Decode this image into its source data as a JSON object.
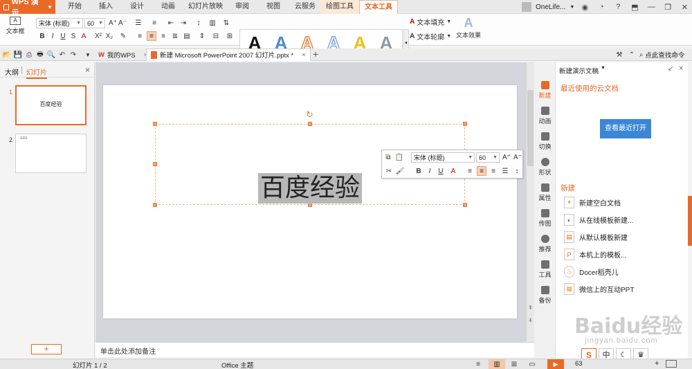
{
  "app": {
    "name": "WPS 演示"
  },
  "menu": {
    "tabs": [
      "开始",
      "插入",
      "设计",
      "动画",
      "幻灯片放映",
      "审阅",
      "视图",
      "云服务",
      "绘图工具",
      "文本工具"
    ],
    "user": "OneLife..."
  },
  "ribbon": {
    "textbox_label": "文本框",
    "font_name": "宋体 (标题)",
    "font_size": "60",
    "fill_label": "文本填充",
    "outline_label": "文本轮廓",
    "effect_label": "文本效果",
    "gallery_letter": "A",
    "gallery_colors": [
      "#111111",
      "#4a8bd1",
      "#e98246",
      "#7fa8d8",
      "#f2c018",
      "#8c99a8"
    ]
  },
  "tabs": {
    "home_tab": "我的WPS",
    "doc_tab": "新建 Microsoft PowerPoint 2007 幻灯片.pptx *",
    "search_placeholder": "点此查找命令"
  },
  "left_panel": {
    "tab_outline": "大纲",
    "tab_slides": "幻灯片",
    "slides": [
      {
        "num": "1",
        "text": "百度经验"
      },
      {
        "num": "2",
        "text": "≡≡≡"
      }
    ]
  },
  "slide": {
    "text": "百度经验"
  },
  "mini_toolbar": {
    "font_name": "宋体 (标题)",
    "font_size": "60"
  },
  "notes": {
    "placeholder": "单击此处添加备注"
  },
  "task_pane": {
    "title": "新建演示文稿",
    "recent_header": "最近使用的云文档",
    "view_recent_button": "查看最近打开",
    "new_header": "新建",
    "items": [
      "新建空白文档",
      "从在线模板新建...",
      "从默认模板新建",
      "本机上的模板...",
      "Docer稻壳儿",
      "微信上的互动PPT"
    ],
    "strip": [
      "新建",
      "动画",
      "切换",
      "形状",
      "属性",
      "传图",
      "推荐",
      "工具",
      "备份"
    ]
  },
  "status": {
    "slide_counter": "幻灯片 1 / 2",
    "theme": "Office 主题",
    "zoom": "63"
  },
  "watermark": {
    "text": "Baidu经验",
    "url": "jingyan.baidu.com"
  },
  "colors": {
    "accent": "#e86a26",
    "blue_button": "#3c86d6"
  }
}
